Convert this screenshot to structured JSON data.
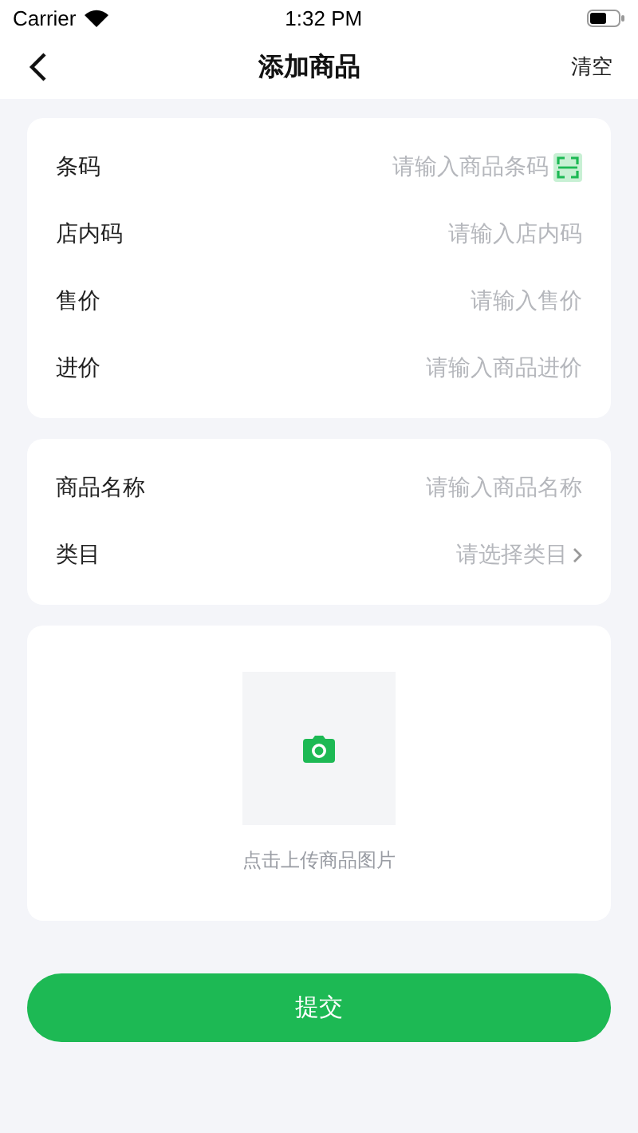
{
  "status_bar": {
    "carrier": "Carrier",
    "time": "1:32 PM"
  },
  "nav": {
    "title": "添加商品",
    "action": "清空"
  },
  "groups": [
    {
      "rows": [
        {
          "kind": "scan",
          "label": "条码",
          "placeholder": "请输入商品条码"
        },
        {
          "kind": "input",
          "label": "店内码",
          "placeholder": "请输入店内码"
        },
        {
          "kind": "input",
          "label": "售价",
          "placeholder": "请输入售价"
        },
        {
          "kind": "input",
          "label": "进价",
          "placeholder": "请输入商品进价"
        }
      ]
    },
    {
      "rows": [
        {
          "kind": "input",
          "label": "商品名称",
          "placeholder": "请输入商品名称"
        },
        {
          "kind": "select",
          "label": "类目",
          "placeholder": "请选择类目"
        }
      ]
    }
  ],
  "upload": {
    "hint": "点击上传商品图片"
  },
  "submit": "提交"
}
